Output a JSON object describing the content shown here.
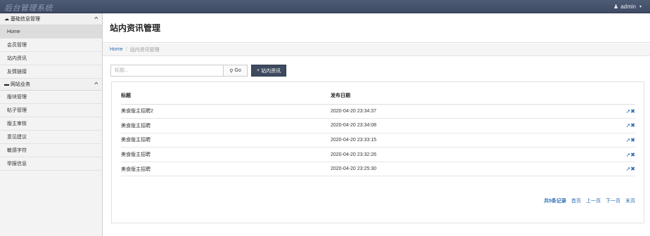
{
  "header": {
    "brand": "后台管理系统",
    "user_icon": "user-icon",
    "user_name": "admin",
    "caret": "▾"
  },
  "sidebar": {
    "groups": [
      {
        "label": "基础信息管理",
        "icon": "cloud-icon",
        "items": [
          "Home",
          "会员管理",
          "站内资讯",
          "友情链接"
        ]
      },
      {
        "label": "网站业务",
        "icon": "folder-icon",
        "items": [
          "版块管理",
          "帖子管理",
          "版主审核",
          "意见建议",
          "敏感字符",
          "举报信息"
        ]
      }
    ]
  },
  "page": {
    "title": "站内资讯管理",
    "breadcrumb": {
      "home": "Home",
      "separator": "/",
      "current": "站内资讯管理"
    }
  },
  "toolbar": {
    "search_placeholder": "标题...",
    "go_label": "Go",
    "add_label": "站内资讯"
  },
  "table": {
    "columns": [
      "标题",
      "发布日期"
    ],
    "rows": [
      {
        "title": "美食版主招聘2",
        "date": "2020-04-20 23:34:37"
      },
      {
        "title": "美食版主招聘",
        "date": "2020-04-20 23:34:08"
      },
      {
        "title": "美食版主招聘",
        "date": "2020-04-20 23:33:15"
      },
      {
        "title": "美食版主招聘",
        "date": "2020-04-20 23:32:26"
      },
      {
        "title": "美食版主招聘",
        "date": "2020-04-20 23:25:30"
      }
    ]
  },
  "pager": {
    "total": "共5条记录",
    "first": "首页",
    "prev": "上一页",
    "next": "下一页",
    "last": "末页"
  },
  "colors": {
    "topbar": "#4d5b76",
    "link": "#2a6ab0",
    "add_button": "#3e4a5f"
  }
}
